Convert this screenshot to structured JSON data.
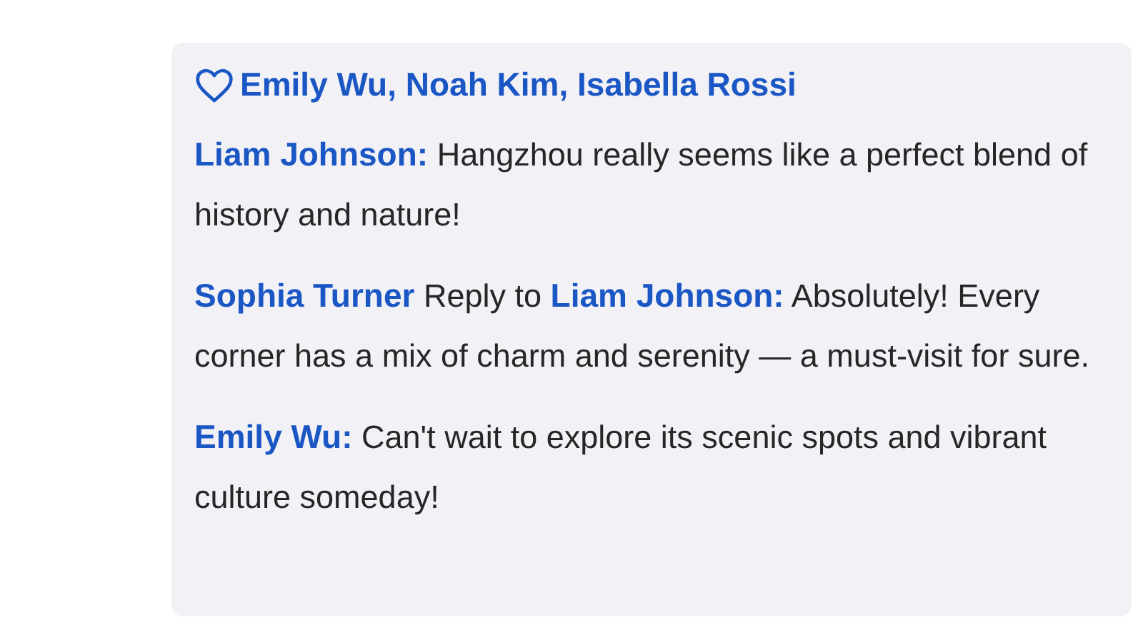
{
  "likes": {
    "names": "Emily Wu, Noah Kim, Isabella Rossi"
  },
  "comments": [
    {
      "author": "Liam Johnson:",
      "text": "Hangzhou really seems like a perfect blend of history and nature!"
    },
    {
      "author": "Sophia Turner",
      "reply_label": "Reply to",
      "reply_to": "Liam Johnson:",
      "text": "Absolutely! Every corner has a mix of charm and serenity — a must-visit for sure."
    },
    {
      "author": "Emily Wu:",
      "text": "Can't wait to explore its scenic spots and vibrant culture someday!"
    }
  ]
}
